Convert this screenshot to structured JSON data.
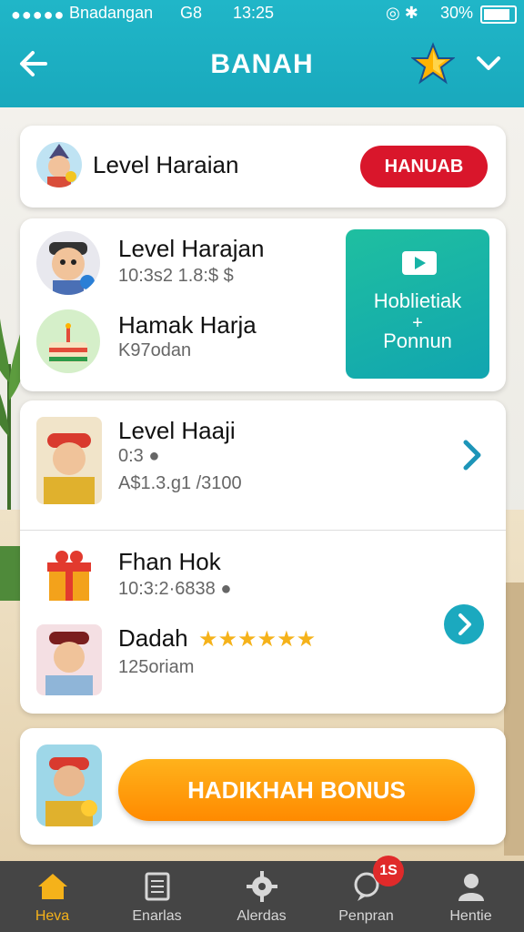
{
  "status_bar": {
    "dots": "●●●●●",
    "carrier": "Bnadangan",
    "network": "G8",
    "time": "13:25",
    "icons": "◎ ✱",
    "battery": "30%"
  },
  "header": {
    "title": "BANAH",
    "back_icon": "arrow-left-icon",
    "star_icon": "star-icon",
    "dropdown_icon": "chevron-down-icon"
  },
  "card1": {
    "title": "Level Haraian",
    "button": "HANUAB"
  },
  "card2": {
    "items": [
      {
        "name": "Level Harajan",
        "sub": "10:3s2 1.8:$ $"
      },
      {
        "name": "Hamak Harja",
        "sub": "K97odan"
      }
    ],
    "promo": {
      "line1": "Hoblietiak",
      "line2": "+",
      "line3": "Ponnun"
    }
  },
  "card3": {
    "items": [
      {
        "name": "Level Haaji",
        "sub1": "0:3 ●",
        "sub2": "A$1.3.g1 /3100"
      },
      {
        "name": "Fhan Hok",
        "sub": "10:3:2·6838 ●"
      },
      {
        "name": "Dadah",
        "stars": "★★★★★★",
        "sub": "125oriam"
      }
    ]
  },
  "card4": {
    "bonus_button": "HADIKHAH BONUS"
  },
  "nav": {
    "items": [
      {
        "label": "Heva",
        "icon": "home-icon",
        "active": true
      },
      {
        "label": "Enarlas",
        "icon": "document-icon",
        "active": false
      },
      {
        "label": "Alerdas",
        "icon": "gear-icon",
        "active": false
      },
      {
        "label": "Penpran",
        "icon": "chat-icon",
        "active": false
      },
      {
        "label": "Hentie",
        "icon": "user-icon",
        "active": false
      }
    ],
    "badge": "1S"
  },
  "colors": {
    "header": "#1aaabd",
    "accent_red": "#d9162b",
    "accent_orange": "#ff9a00",
    "promo_green": "#17b3a6",
    "nav_bg": "#454545",
    "nav_active": "#f5b21a"
  }
}
